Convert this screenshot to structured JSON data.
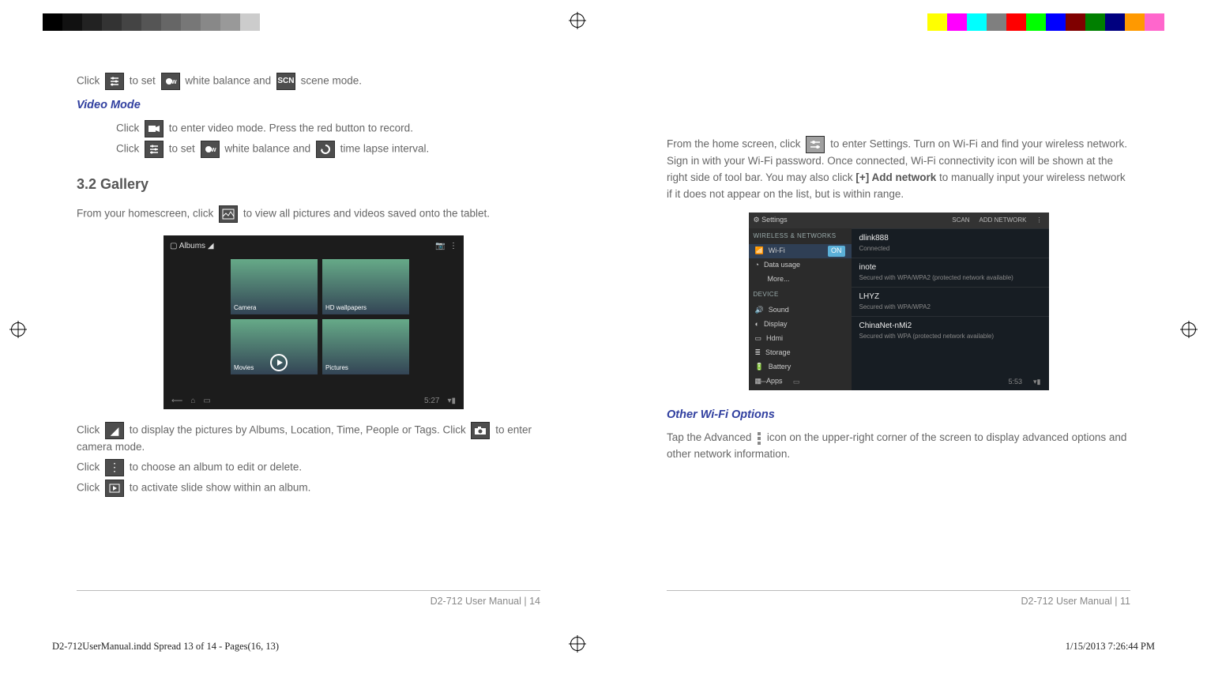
{
  "colorbar_left_swatches": [
    "#000",
    "#111",
    "#222",
    "#333",
    "#444",
    "#555",
    "#666",
    "#777",
    "#888",
    "#999",
    "#ccc",
    "#fff"
  ],
  "colorbar_right_swatches": [
    "#ffff00",
    "#ff00ff",
    "#00ffff",
    "#7f7f7f",
    "#ff0000",
    "#00ff00",
    "#0000ff",
    "#7f0000",
    "#007f00",
    "#00007f",
    "#ff9900",
    "#ff66cc"
  ],
  "left_page": {
    "l1_a": "Click ",
    "l1_b": " to set ",
    "l1_c": " white balance and ",
    "l1_d": " scene mode.",
    "h_video": "Video Mode",
    "l2_a": "Click ",
    "l2_b": " to enter video mode. Press the red button to record.",
    "l3_a": "Click ",
    "l3_b": " to set ",
    "l3_c": " white balance and ",
    "l3_d": " time lapse interval.",
    "h_gallery": "3.2 Gallery",
    "l4_a": "From your homescreen, click ",
    "l4_b": " to view all pictures and videos saved onto the tablet.",
    "shot": {
      "top_label": "Albums",
      "tile_labels": [
        "Camera",
        "HD wallpapers",
        "Movies",
        "Pictures"
      ],
      "clock": "5:27"
    },
    "l5_a": "Click ",
    "l5_b": " to display the pictures by Albums, Location, Time, People or Tags. Click ",
    "l5_c": " to enter camera mode.",
    "l6_a": "Click ",
    "l6_b": " to choose an album to edit or delete.",
    "l7_a": "Click ",
    "l7_b": " to activate slide show within an album.",
    "footer": "D2-712 User Manual | 14"
  },
  "right_page": {
    "p1_a": "From the home screen, click ",
    "p1_b": " to enter Settings. Turn on Wi-Fi and find your wireless network. Sign in with your Wi-Fi password. Once connected, Wi-Fi connectivity icon will be shown at the right side of tool bar. You may also click ",
    "p1_bold": "[+] Add network",
    "p1_c": " to manually input your wireless network if it does not appear on the list, but is within range.",
    "shot": {
      "title": "Settings",
      "scan": "SCAN",
      "addnet": "ADD NETWORK",
      "sect_wireless": "WIRELESS & NETWORKS",
      "wifi": "Wi-Fi",
      "on": "ON",
      "datausage": "Data usage",
      "more": "More...",
      "sect_device": "DEVICE",
      "sound": "Sound",
      "display": "Display",
      "hdmi": "Hdmi",
      "storage": "Storage",
      "battery": "Battery",
      "apps": "Apps",
      "nets": [
        {
          "n": "dlink888",
          "s": "Connected"
        },
        {
          "n": "inote",
          "s": "Secured with WPA/WPA2 (protected network available)"
        },
        {
          "n": "LHYZ",
          "s": "Secured with WPA/WPA2"
        },
        {
          "n": "ChinaNet-nMi2",
          "s": "Secured with WPA (protected network available)"
        }
      ],
      "clock": "5:53"
    },
    "h_other": "Other Wi-Fi Options",
    "p2_a": "Tap the Advanced ",
    "p2_b": " icon on the upper-right corner of the screen to display advanced options and other network information.",
    "footer": "D2-712 User Manual | 11"
  },
  "slug_left": "D2-712UserManual.indd   Spread 13 of 14 - Pages(16, 13)",
  "slug_right": "1/15/2013   7:26:44 PM"
}
